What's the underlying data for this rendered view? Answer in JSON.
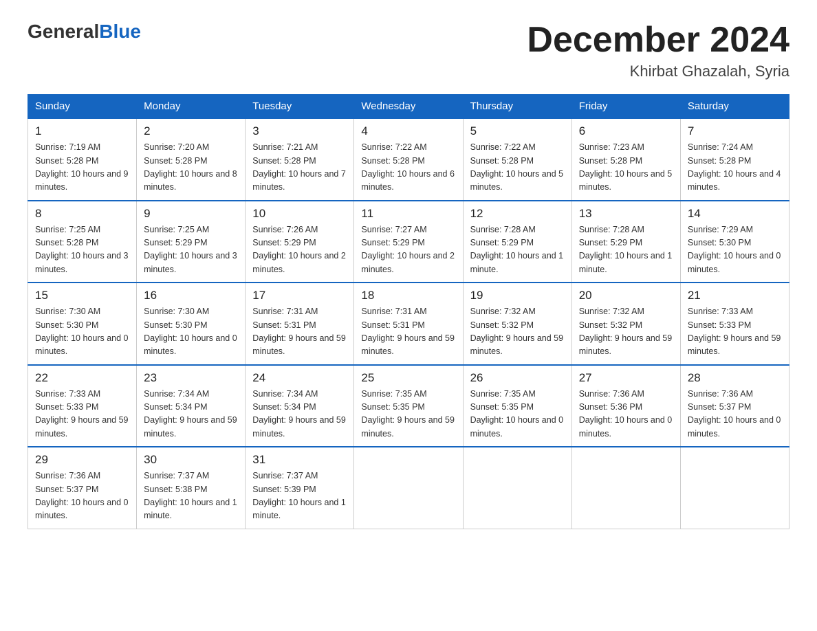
{
  "logo": {
    "general": "General",
    "blue": "Blue"
  },
  "title": "December 2024",
  "location": "Khirbat Ghazalah, Syria",
  "days_of_week": [
    "Sunday",
    "Monday",
    "Tuesday",
    "Wednesday",
    "Thursday",
    "Friday",
    "Saturday"
  ],
  "weeks": [
    [
      {
        "day": "1",
        "sunrise": "7:19 AM",
        "sunset": "5:28 PM",
        "daylight": "10 hours and 9 minutes."
      },
      {
        "day": "2",
        "sunrise": "7:20 AM",
        "sunset": "5:28 PM",
        "daylight": "10 hours and 8 minutes."
      },
      {
        "day": "3",
        "sunrise": "7:21 AM",
        "sunset": "5:28 PM",
        "daylight": "10 hours and 7 minutes."
      },
      {
        "day": "4",
        "sunrise": "7:22 AM",
        "sunset": "5:28 PM",
        "daylight": "10 hours and 6 minutes."
      },
      {
        "day": "5",
        "sunrise": "7:22 AM",
        "sunset": "5:28 PM",
        "daylight": "10 hours and 5 minutes."
      },
      {
        "day": "6",
        "sunrise": "7:23 AM",
        "sunset": "5:28 PM",
        "daylight": "10 hours and 5 minutes."
      },
      {
        "day": "7",
        "sunrise": "7:24 AM",
        "sunset": "5:28 PM",
        "daylight": "10 hours and 4 minutes."
      }
    ],
    [
      {
        "day": "8",
        "sunrise": "7:25 AM",
        "sunset": "5:28 PM",
        "daylight": "10 hours and 3 minutes."
      },
      {
        "day": "9",
        "sunrise": "7:25 AM",
        "sunset": "5:29 PM",
        "daylight": "10 hours and 3 minutes."
      },
      {
        "day": "10",
        "sunrise": "7:26 AM",
        "sunset": "5:29 PM",
        "daylight": "10 hours and 2 minutes."
      },
      {
        "day": "11",
        "sunrise": "7:27 AM",
        "sunset": "5:29 PM",
        "daylight": "10 hours and 2 minutes."
      },
      {
        "day": "12",
        "sunrise": "7:28 AM",
        "sunset": "5:29 PM",
        "daylight": "10 hours and 1 minute."
      },
      {
        "day": "13",
        "sunrise": "7:28 AM",
        "sunset": "5:29 PM",
        "daylight": "10 hours and 1 minute."
      },
      {
        "day": "14",
        "sunrise": "7:29 AM",
        "sunset": "5:30 PM",
        "daylight": "10 hours and 0 minutes."
      }
    ],
    [
      {
        "day": "15",
        "sunrise": "7:30 AM",
        "sunset": "5:30 PM",
        "daylight": "10 hours and 0 minutes."
      },
      {
        "day": "16",
        "sunrise": "7:30 AM",
        "sunset": "5:30 PM",
        "daylight": "10 hours and 0 minutes."
      },
      {
        "day": "17",
        "sunrise": "7:31 AM",
        "sunset": "5:31 PM",
        "daylight": "9 hours and 59 minutes."
      },
      {
        "day": "18",
        "sunrise": "7:31 AM",
        "sunset": "5:31 PM",
        "daylight": "9 hours and 59 minutes."
      },
      {
        "day": "19",
        "sunrise": "7:32 AM",
        "sunset": "5:32 PM",
        "daylight": "9 hours and 59 minutes."
      },
      {
        "day": "20",
        "sunrise": "7:32 AM",
        "sunset": "5:32 PM",
        "daylight": "9 hours and 59 minutes."
      },
      {
        "day": "21",
        "sunrise": "7:33 AM",
        "sunset": "5:33 PM",
        "daylight": "9 hours and 59 minutes."
      }
    ],
    [
      {
        "day": "22",
        "sunrise": "7:33 AM",
        "sunset": "5:33 PM",
        "daylight": "9 hours and 59 minutes."
      },
      {
        "day": "23",
        "sunrise": "7:34 AM",
        "sunset": "5:34 PM",
        "daylight": "9 hours and 59 minutes."
      },
      {
        "day": "24",
        "sunrise": "7:34 AM",
        "sunset": "5:34 PM",
        "daylight": "9 hours and 59 minutes."
      },
      {
        "day": "25",
        "sunrise": "7:35 AM",
        "sunset": "5:35 PM",
        "daylight": "9 hours and 59 minutes."
      },
      {
        "day": "26",
        "sunrise": "7:35 AM",
        "sunset": "5:35 PM",
        "daylight": "10 hours and 0 minutes."
      },
      {
        "day": "27",
        "sunrise": "7:36 AM",
        "sunset": "5:36 PM",
        "daylight": "10 hours and 0 minutes."
      },
      {
        "day": "28",
        "sunrise": "7:36 AM",
        "sunset": "5:37 PM",
        "daylight": "10 hours and 0 minutes."
      }
    ],
    [
      {
        "day": "29",
        "sunrise": "7:36 AM",
        "sunset": "5:37 PM",
        "daylight": "10 hours and 0 minutes."
      },
      {
        "day": "30",
        "sunrise": "7:37 AM",
        "sunset": "5:38 PM",
        "daylight": "10 hours and 1 minute."
      },
      {
        "day": "31",
        "sunrise": "7:37 AM",
        "sunset": "5:39 PM",
        "daylight": "10 hours and 1 minute."
      },
      null,
      null,
      null,
      null
    ]
  ]
}
